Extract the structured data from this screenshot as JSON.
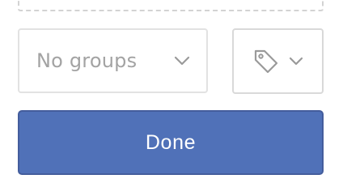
{
  "groups_select": {
    "selected_value": "No groups",
    "chevron_icon": "chevron-down-icon"
  },
  "tag_select": {
    "icon": "tag-icon",
    "chevron_icon": "chevron-down-icon"
  },
  "done_button": {
    "label": "Done"
  },
  "colors": {
    "primary_button": "#5071b8",
    "primary_button_border": "#445d9c",
    "placeholder_text": "#a3a3a3",
    "input_border": "#e2e2e2",
    "dashed_border": "#d3d3d3"
  }
}
